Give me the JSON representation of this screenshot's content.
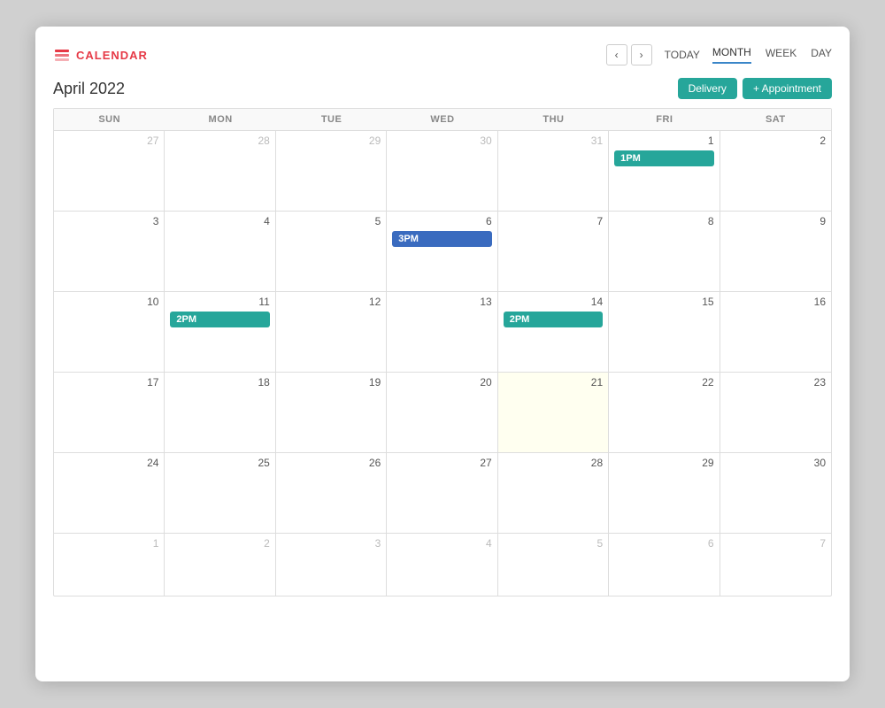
{
  "app": {
    "logo_text": "CALENDAR",
    "logo_icon": "calendar-stack"
  },
  "nav": {
    "today_label": "TODAY",
    "views": [
      "MONTH",
      "WEEK",
      "DAY"
    ],
    "active_view": "MONTH"
  },
  "header": {
    "month_title": "April 2022",
    "btn_delivery": "Delivery",
    "btn_appointment": "+ Appointment"
  },
  "calendar": {
    "days_of_week": [
      "SUN",
      "MON",
      "TUE",
      "WED",
      "THU",
      "FRI",
      "SAT"
    ],
    "weeks": [
      {
        "days": [
          {
            "num": "27",
            "other": true,
            "today": false,
            "events": []
          },
          {
            "num": "28",
            "other": true,
            "today": false,
            "events": []
          },
          {
            "num": "29",
            "other": true,
            "today": false,
            "events": []
          },
          {
            "num": "30",
            "other": true,
            "today": false,
            "events": []
          },
          {
            "num": "31",
            "other": true,
            "today": false,
            "events": []
          },
          {
            "num": "1",
            "other": false,
            "today": false,
            "events": [
              {
                "label": "1PM",
                "type": "teal"
              }
            ]
          },
          {
            "num": "2",
            "other": false,
            "today": false,
            "events": []
          }
        ]
      },
      {
        "days": [
          {
            "num": "3",
            "other": false,
            "today": false,
            "events": []
          },
          {
            "num": "4",
            "other": false,
            "today": false,
            "events": []
          },
          {
            "num": "5",
            "other": false,
            "today": false,
            "events": []
          },
          {
            "num": "6",
            "other": false,
            "today": false,
            "events": [
              {
                "label": "3PM",
                "type": "blue"
              }
            ]
          },
          {
            "num": "7",
            "other": false,
            "today": false,
            "events": []
          },
          {
            "num": "8",
            "other": false,
            "today": false,
            "events": []
          },
          {
            "num": "9",
            "other": false,
            "today": false,
            "events": []
          }
        ]
      },
      {
        "days": [
          {
            "num": "10",
            "other": false,
            "today": false,
            "events": []
          },
          {
            "num": "11",
            "other": false,
            "today": false,
            "events": [
              {
                "label": "2PM",
                "type": "teal"
              }
            ]
          },
          {
            "num": "12",
            "other": false,
            "today": false,
            "events": []
          },
          {
            "num": "13",
            "other": false,
            "today": false,
            "events": []
          },
          {
            "num": "14",
            "other": false,
            "today": false,
            "events": [
              {
                "label": "2PM",
                "type": "teal"
              }
            ]
          },
          {
            "num": "15",
            "other": false,
            "today": false,
            "events": []
          },
          {
            "num": "16",
            "other": false,
            "today": false,
            "events": []
          }
        ]
      },
      {
        "days": [
          {
            "num": "17",
            "other": false,
            "today": false,
            "events": []
          },
          {
            "num": "18",
            "other": false,
            "today": false,
            "events": []
          },
          {
            "num": "19",
            "other": false,
            "today": false,
            "events": []
          },
          {
            "num": "20",
            "other": false,
            "today": false,
            "events": []
          },
          {
            "num": "21",
            "other": false,
            "today": true,
            "events": []
          },
          {
            "num": "22",
            "other": false,
            "today": false,
            "events": []
          },
          {
            "num": "23",
            "other": false,
            "today": false,
            "events": []
          }
        ]
      },
      {
        "days": [
          {
            "num": "24",
            "other": false,
            "today": false,
            "events": []
          },
          {
            "num": "25",
            "other": false,
            "today": false,
            "events": []
          },
          {
            "num": "26",
            "other": false,
            "today": false,
            "events": []
          },
          {
            "num": "27",
            "other": false,
            "today": false,
            "events": []
          },
          {
            "num": "28",
            "other": false,
            "today": false,
            "events": []
          },
          {
            "num": "29",
            "other": false,
            "today": false,
            "events": []
          },
          {
            "num": "30",
            "other": false,
            "today": false,
            "events": []
          }
        ]
      },
      {
        "days": [
          {
            "num": "1",
            "other": true,
            "today": false,
            "events": []
          },
          {
            "num": "2",
            "other": true,
            "today": false,
            "events": []
          },
          {
            "num": "3",
            "other": true,
            "today": false,
            "events": []
          },
          {
            "num": "4",
            "other": true,
            "today": false,
            "events": []
          },
          {
            "num": "5",
            "other": true,
            "today": false,
            "events": []
          },
          {
            "num": "6",
            "other": true,
            "today": false,
            "events": []
          },
          {
            "num": "7",
            "other": true,
            "today": false,
            "events": []
          }
        ]
      }
    ]
  }
}
